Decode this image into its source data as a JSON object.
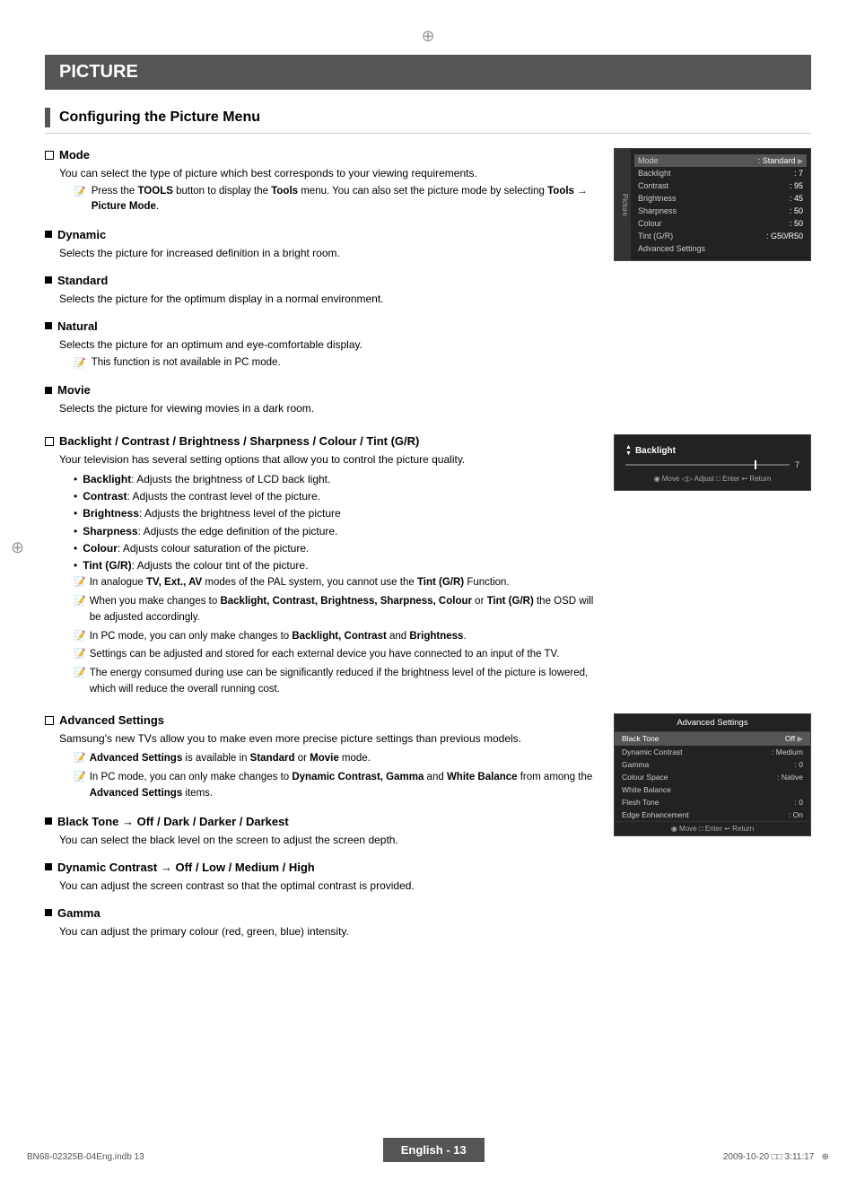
{
  "page": {
    "title": "PICTURE",
    "section_title": "Configuring the Picture Menu",
    "footer_label": "English - 13",
    "footer_left": "BN68-02325B-04Eng.indb   13",
    "footer_right": "2009-10-20   □□ 3:11:17"
  },
  "mode_topic": {
    "heading": "Mode",
    "body": "You can select the type of picture which best corresponds to your viewing requirements.",
    "note": "Press the TOOLS button to display the Tools menu. You can also set the picture mode by selecting Tools → Picture Mode."
  },
  "dynamic": {
    "heading": "Dynamic",
    "body": "Selects the picture for increased definition in a bright room."
  },
  "standard": {
    "heading": "Standard",
    "body": "Selects the picture for the optimum display in a normal environment."
  },
  "natural": {
    "heading": "Natural",
    "body": "Selects the picture for an optimum and eye-comfortable display.",
    "note": "This function is not available in PC mode."
  },
  "movie": {
    "heading": "Movie",
    "body": "Selects the picture for viewing movies in a dark room."
  },
  "backlight_topic": {
    "heading": "Backlight / Contrast / Brightness / Sharpness / Colour / Tint (G/R)",
    "body": "Your television has several setting options that allow you to control the picture quality.",
    "bullets": [
      "Backlight: Adjusts the brightness of LCD back light.",
      "Contrast: Adjusts the contrast level of the picture.",
      "Brightness: Adjusts the brightness level of the picture",
      "Sharpness: Adjusts the edge definition of the picture.",
      "Colour: Adjusts colour saturation of the picture.",
      "Tint (G/R): Adjusts the colour tint of the picture."
    ],
    "notes": [
      "In analogue TV, Ext., AV modes of the PAL system, you cannot use the Tint (G/R) Function.",
      "When you make changes to Backlight, Contrast, Brightness, Sharpness, Colour or Tint (G/R) the OSD will be adjusted accordingly.",
      "In PC mode, you can only make changes to Backlight, Contrast and Brightness.",
      "Settings can be adjusted and stored for each external device you have connected to an input of the TV.",
      "The energy consumed during use can be significantly reduced if the brightness level of the picture is lowered, which will reduce the overall running cost."
    ]
  },
  "advanced_topic": {
    "heading": "Advanced Settings",
    "body": "Samsung's new TVs allow you to make even more precise picture settings than previous models.",
    "notes": [
      "Advanced Settings is available in Standard or Movie mode.",
      "In PC mode, you can only make changes to Dynamic Contrast, Gamma and White Balance from among the Advanced Settings items."
    ]
  },
  "black_tone": {
    "heading": "Black Tone → Off / Dark / Darker / Darkest",
    "body": "You can select the black level on the screen to adjust the screen depth."
  },
  "dynamic_contrast": {
    "heading": "Dynamic Contrast → Off / Low / Medium / High",
    "body": "You can adjust the screen contrast so that the optimal contrast is provided."
  },
  "gamma": {
    "heading": "Gamma",
    "body": "You can adjust the primary colour (red, green, blue) intensity."
  },
  "tv_menu": {
    "mode_label": "Mode",
    "mode_value": "Standard",
    "rows": [
      {
        "label": "Backlight",
        "value": ": 7"
      },
      {
        "label": "Contrast",
        "value": ": 95"
      },
      {
        "label": "Brightness",
        "value": ": 45"
      },
      {
        "label": "Sharpness",
        "value": ": 50"
      },
      {
        "label": "Colour",
        "value": ": 50"
      },
      {
        "label": "Tint (G/R)",
        "value": ": G50/R50"
      },
      {
        "label": "Advanced Settings",
        "value": ""
      }
    ],
    "sidebar_label": "Picture"
  },
  "backlight_slider": {
    "title": "Backlight",
    "value": "7",
    "footer": "◉ Move  ◁▷ Adjust  □ Enter  ↩ Return"
  },
  "advanced_settings": {
    "title": "Advanced Settings",
    "rows": [
      {
        "label": "Black Tone",
        "value": "Off",
        "highlighted": true
      },
      {
        "label": "Dynamic Contrast",
        "value": ": Medium"
      },
      {
        "label": "Gamma",
        "value": ": 0"
      },
      {
        "label": "Colour Space",
        "value": ": Native"
      },
      {
        "label": "White Balance",
        "value": ""
      },
      {
        "label": "Flesh Tone",
        "value": ": 0"
      },
      {
        "label": "Edge Enhancement",
        "value": ": On"
      }
    ],
    "footer": "◉ Move  □ Enter  ↩ Return"
  }
}
